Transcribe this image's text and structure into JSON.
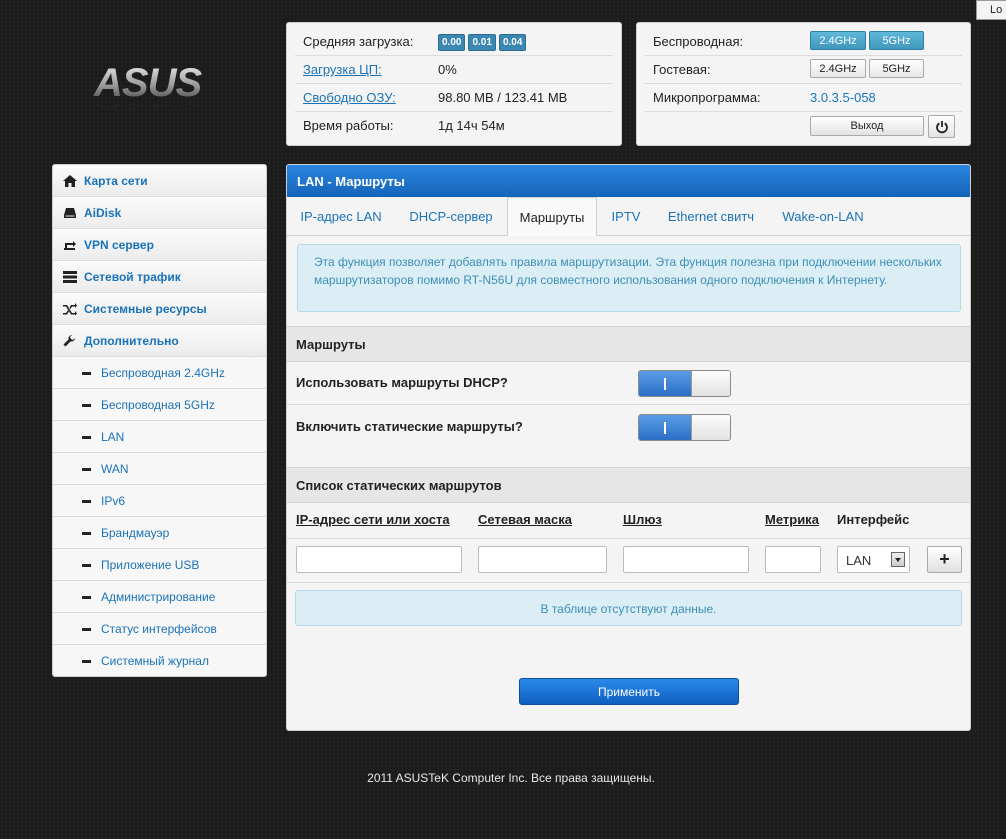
{
  "top_right": {
    "label": "Lo"
  },
  "logo": {
    "text": "ASUS"
  },
  "status_left": {
    "rows": [
      {
        "label": "Средняя загрузка:",
        "badges": [
          "0.00",
          "0.01",
          "0.04"
        ]
      },
      {
        "label": "Загрузка ЦП:",
        "value": "0%"
      },
      {
        "label": "Свободно ОЗУ:",
        "value": "98.80 MB / 123.41 MB"
      },
      {
        "label": "Время работы:",
        "value": "1д 14ч 54м"
      }
    ]
  },
  "status_right": {
    "wireless_label": "Беспроводная:",
    "guest_label": "Гостевая:",
    "firmware_label": "Микропрограмма:",
    "firmware_value": "3.0.3.5-058",
    "band_24": "2.4GHz",
    "band_5": "5GHz",
    "logout_label": "Выход"
  },
  "sidebar": {
    "main_items": [
      {
        "label": "Карта сети",
        "icon": "home-icon"
      },
      {
        "label": "AiDisk",
        "icon": "disk-icon"
      },
      {
        "label": "VPN сервер",
        "icon": "vpn-icon"
      },
      {
        "label": "Сетевой трафик",
        "icon": "traffic-icon"
      },
      {
        "label": "Системные ресурсы",
        "icon": "resources-icon"
      },
      {
        "label": "Дополнительно",
        "icon": "wrench-icon"
      }
    ],
    "sub_items": [
      {
        "label": "Беспроводная 2.4GHz"
      },
      {
        "label": "Беспроводная 5GHz"
      },
      {
        "label": "LAN"
      },
      {
        "label": "WAN"
      },
      {
        "label": "IPv6"
      },
      {
        "label": "Брандмауэр"
      },
      {
        "label": "Приложение USB"
      },
      {
        "label": "Администрирование"
      },
      {
        "label": "Статус интерфейсов"
      },
      {
        "label": "Системный журнал"
      }
    ],
    "active_sub": "LAN"
  },
  "main": {
    "title": "LAN - Маршруты",
    "tabs": [
      "IP-адрес LAN",
      "DHCP-сервер",
      "Маршруты",
      "IPTV",
      "Ethernet свитч",
      "Wake-on-LAN"
    ],
    "active_tab": "Маршруты",
    "info_text": "Эта функция позволяет добавлять правила маршрутизации. Эта функция полезна при подключении нескольких маршрутизаторов помимо RT-N56U для совместного использования одного подключения к Интернету.",
    "routes_section": "Маршруты",
    "use_dhcp_routes": {
      "label": "Использовать маршруты DHCP?",
      "on": true
    },
    "static_routes": {
      "label": "Включить статические маршруты?",
      "on": true
    },
    "static_list_section": "Список статических маршрутов",
    "columns": [
      "IP-адрес сети или хоста",
      "Сетевая маска",
      "Шлюз",
      "Метрика",
      "Интерфейс"
    ],
    "interface_value": "LAN",
    "add_label": "+",
    "empty_text": "В таблице отсутствуют данные.",
    "apply_label": "Применить"
  },
  "footer": {
    "text": "2011 ASUSTeK Computer Inc. Все права защищены."
  }
}
